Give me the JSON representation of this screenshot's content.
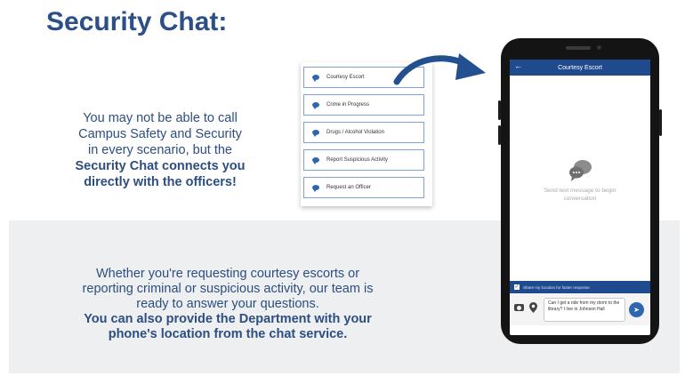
{
  "slide": {
    "title": "Security Chat:",
    "top_text": {
      "line1": "You may not be able to call",
      "line2": "Campus Safety and Security",
      "line3": "in every scenario, but the",
      "bold1": "Security Chat connects you",
      "bold2": "directly with the officers!"
    },
    "bottom_text": {
      "line1": "Whether you're requesting courtesy escorts or",
      "line2": "reporting criminal or suspicious activity, our team is",
      "line3": "ready to answer your questions.",
      "bold1": "You can also provide the Department with your",
      "bold2": "phone's location from the chat service."
    }
  },
  "menu": {
    "items": [
      {
        "label": "Courtesy Escort"
      },
      {
        "label": "Crime in Progress"
      },
      {
        "label": "Drugs / Alcohol Violation"
      },
      {
        "label": "Report Suspicious Activity"
      },
      {
        "label": "Request an Officer"
      }
    ]
  },
  "phone": {
    "header_title": "Courtesy Escort",
    "empty_state": "Send text message to begin conversation",
    "location_label": "Share my location for faster response",
    "message_text": "Can I get a ride from my dorm to the library? I live in Johnson Hall"
  },
  "colors": {
    "title": "#2b4f86",
    "text": "#2c4e80",
    "app_header": "#1f4b8e",
    "accent": "#2e66b0",
    "band": "#eeeff1"
  },
  "icons": {
    "menu_item": "chat-bubble-icon",
    "arrow": "curved-arrow-icon",
    "empty_state": "chat-bubbles-icon",
    "camera": "camera-icon",
    "location": "location-pin-icon",
    "send": "send-icon",
    "back": "back-arrow-icon"
  }
}
